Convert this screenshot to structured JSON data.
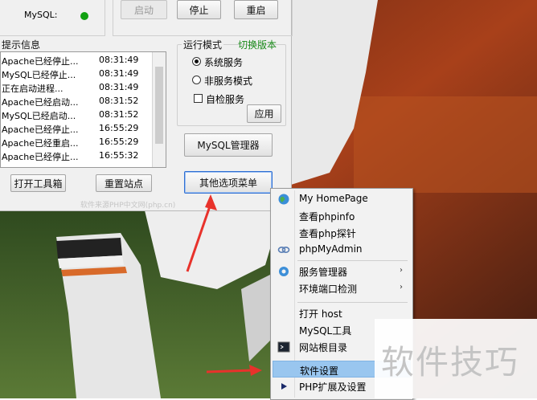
{
  "status": {
    "mysql_label": "MySQL:",
    "mysql_status_color": "#11a011"
  },
  "service_buttons": {
    "start": "启动",
    "stop": "停止",
    "restart": "重启"
  },
  "log": {
    "title": "提示信息",
    "rows": [
      {
        "msg": "Apache已经停止...",
        "time": "08:31:49"
      },
      {
        "msg": "MySQL已经停止...",
        "time": "08:31:49"
      },
      {
        "msg": "正在启动进程...",
        "time": "08:31:49"
      },
      {
        "msg": "Apache已经启动...",
        "time": "08:31:52"
      },
      {
        "msg": "MySQL已经启动...",
        "time": "08:31:52"
      },
      {
        "msg": "Apache已经停止...",
        "time": "16:55:29"
      },
      {
        "msg": "Apache已经重启...",
        "time": "16:55:29"
      },
      {
        "msg": "Apache已经停止...",
        "time": "16:55:32"
      }
    ]
  },
  "run_mode": {
    "title": "运行模式",
    "switch_version": "切换版本",
    "options": [
      "系统服务",
      "非服务模式"
    ],
    "selected_index": 0,
    "self_check_label": "自检服务",
    "apply_label": "应用"
  },
  "buttons": {
    "mysql_manager": "MySQL管理器",
    "toolbox": "打开工具箱",
    "reset_site": "重置站点",
    "other_menu": "其他选项菜单"
  },
  "credit": "软件来源PHP中文网(php.cn)",
  "context_menu": {
    "items": [
      {
        "label": "My HomePage",
        "icon": "globe-icon"
      },
      {
        "label": "查看phpinfo",
        "icon": ""
      },
      {
        "label": "查看php探针",
        "icon": ""
      },
      {
        "label": "phpMyAdmin",
        "icon": "phpmyadmin-icon"
      },
      {
        "label": "服务管理器",
        "icon": "gear-icon",
        "submenu": true
      },
      {
        "label": "环境端口检测",
        "icon": "",
        "submenu": true
      },
      {
        "label": "打开 host",
        "icon": ""
      },
      {
        "label": "MySQL工具",
        "icon": ""
      },
      {
        "label": "网站根目录",
        "icon": "terminal-icon"
      },
      {
        "label": "软件设置",
        "icon": "",
        "highlighted": true
      },
      {
        "label": "PHP扩展及设置",
        "icon": "play-icon"
      }
    ]
  },
  "watermark": "软件技巧",
  "colors": {
    "menu_highlight": "#99c6ef",
    "switch_version": "#1a8a1a",
    "arrow": "#e8322b"
  }
}
